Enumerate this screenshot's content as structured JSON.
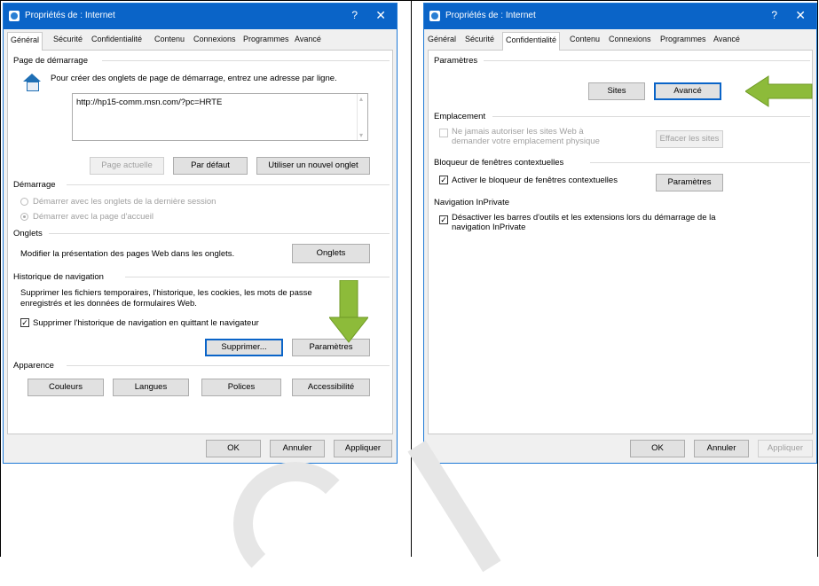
{
  "dialog_left": {
    "title": "Propriétés de : Internet",
    "help": "?",
    "close": "✕",
    "tabs": [
      "Général",
      "Sécurité",
      "Confidentialité",
      "Contenu",
      "Connexions",
      "Programmes",
      "Avancé"
    ],
    "home": {
      "section": "Page de démarrage",
      "description": "Pour créer des onglets de page de démarrage, entrez une adresse par ligne.",
      "url": "http://hp15-comm.msn.com/?pc=HRTE",
      "btn_current": "Page actuelle",
      "btn_default": "Par défaut",
      "btn_newtab": "Utiliser un nouvel onglet"
    },
    "startup": {
      "section": "Démarrage",
      "opt_tabs": "Démarrer avec les onglets de la dernière session",
      "opt_home": "Démarrer avec la page d'accueil"
    },
    "tabs_group": {
      "section": "Onglets",
      "description": "Modifier la présentation des pages Web dans les onglets.",
      "button": "Onglets"
    },
    "history": {
      "section": "Historique de navigation",
      "line1": "Supprimer les fichiers temporaires, l'historique, les cookies, les mots de passe",
      "line2": "enregistrés et les données de formulaires Web.",
      "checkbox": "Supprimer l'historique de navigation en quittant le navigateur",
      "btn_delete": "Supprimer...",
      "btn_settings": "Paramètres"
    },
    "appearance": {
      "section": "Apparence",
      "btn_colors": "Couleurs",
      "btn_languages": "Langues",
      "btn_fonts": "Polices",
      "btn_access": "Accessibilité"
    },
    "footer": {
      "ok": "OK",
      "cancel": "Annuler",
      "apply": "Appliquer"
    }
  },
  "dialog_right": {
    "title": "Propriétés de : Internet",
    "help": "?",
    "close": "✕",
    "tabs": [
      "Général",
      "Sécurité",
      "Confidentialité",
      "Contenu",
      "Connexions",
      "Programmes",
      "Avancé"
    ],
    "settings": {
      "section": "Paramètres",
      "btn_sites": "Sites",
      "btn_advanced": "Avancé"
    },
    "location": {
      "section": "Emplacement",
      "line1": "Ne jamais autoriser les sites Web à",
      "line2": "demander votre emplacement physique",
      "btn_clear": "Effacer les sites"
    },
    "popup": {
      "section": "Bloqueur de fenêtres contextuelles",
      "checkbox": "Activer le bloqueur de fenêtres contextuelles",
      "button": "Paramètres"
    },
    "inprivate": {
      "section": "Navigation InPrivate",
      "line1": "Désactiver les barres d'outils et les extensions lors du démarrage de la",
      "line2": "navigation InPrivate"
    },
    "footer": {
      "ok": "OK",
      "cancel": "Annuler",
      "apply": "Appliquer"
    }
  },
  "colors": {
    "titlebar": "#0a64c8",
    "arrow": "#8dbb3a",
    "arrow_dark": "#6f9a25"
  }
}
